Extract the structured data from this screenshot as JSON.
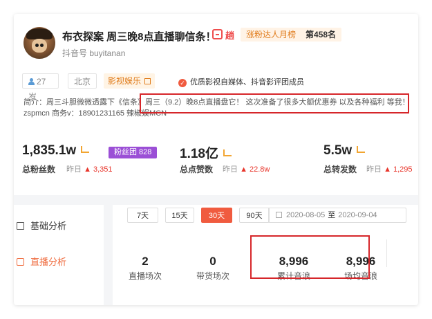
{
  "profile": {
    "name": "布衣探案 周三晚8点直播聊信条！",
    "douyin_id": "抖音号 buyitanan",
    "shop_icon_glyph": "趟",
    "rank_label": "涨粉达人月榜",
    "rank_value": "第458名",
    "age": "27岁",
    "city": "北京",
    "category": "影视娱乐",
    "certification": "优质影视自媒体、抖音影评团成员",
    "bio_line1": "简介：周三斗胆微微透露下《信条》周三（9.2）晚8点直播盘它！ 这次准备了很多大额优惠券 以及各种福利 等我！",
    "bio_line2": "zspmcn 商务v：18901231165 辣椒娱MCN",
    "bio_line2_tail_glyph": "🎁"
  },
  "stats": [
    {
      "value": "1,835.1w",
      "label": "总粉丝数",
      "yesterday_label": "昨日",
      "delta": "▲ 3,351"
    },
    {
      "value": "1.18亿",
      "label": "总点赞数",
      "yesterday_label": "昨日",
      "delta": "▲ 22.8w"
    },
    {
      "value": "5.5w",
      "label": "总转发数",
      "yesterday_label": "昨日",
      "delta": "▲ 1,295"
    }
  ],
  "fans_badge": "粉丝团 828",
  "sidebar": {
    "items": [
      {
        "label": "基础分析",
        "icon": "bar-chart-icon"
      },
      {
        "label": "直播分析",
        "icon": "live-icon"
      }
    ]
  },
  "range_buttons": [
    "7天",
    "15天",
    "30天",
    "90天"
  ],
  "active_range": "30天",
  "date_range": {
    "start": "2020-08-05",
    "separator": "至",
    "end": "2020-09-04"
  },
  "metrics": [
    {
      "value": "2",
      "label": "直播场次"
    },
    {
      "value": "0",
      "label": "带货场次"
    },
    {
      "value": "8,996",
      "label": "累计音浪"
    },
    {
      "value": "8,996",
      "label": "场均音浪"
    }
  ],
  "colors": {
    "accent": "#f05b3f",
    "highlight_border": "#d6262a",
    "fans_badge": "#9b4fd6",
    "category": "#e07b1a"
  }
}
